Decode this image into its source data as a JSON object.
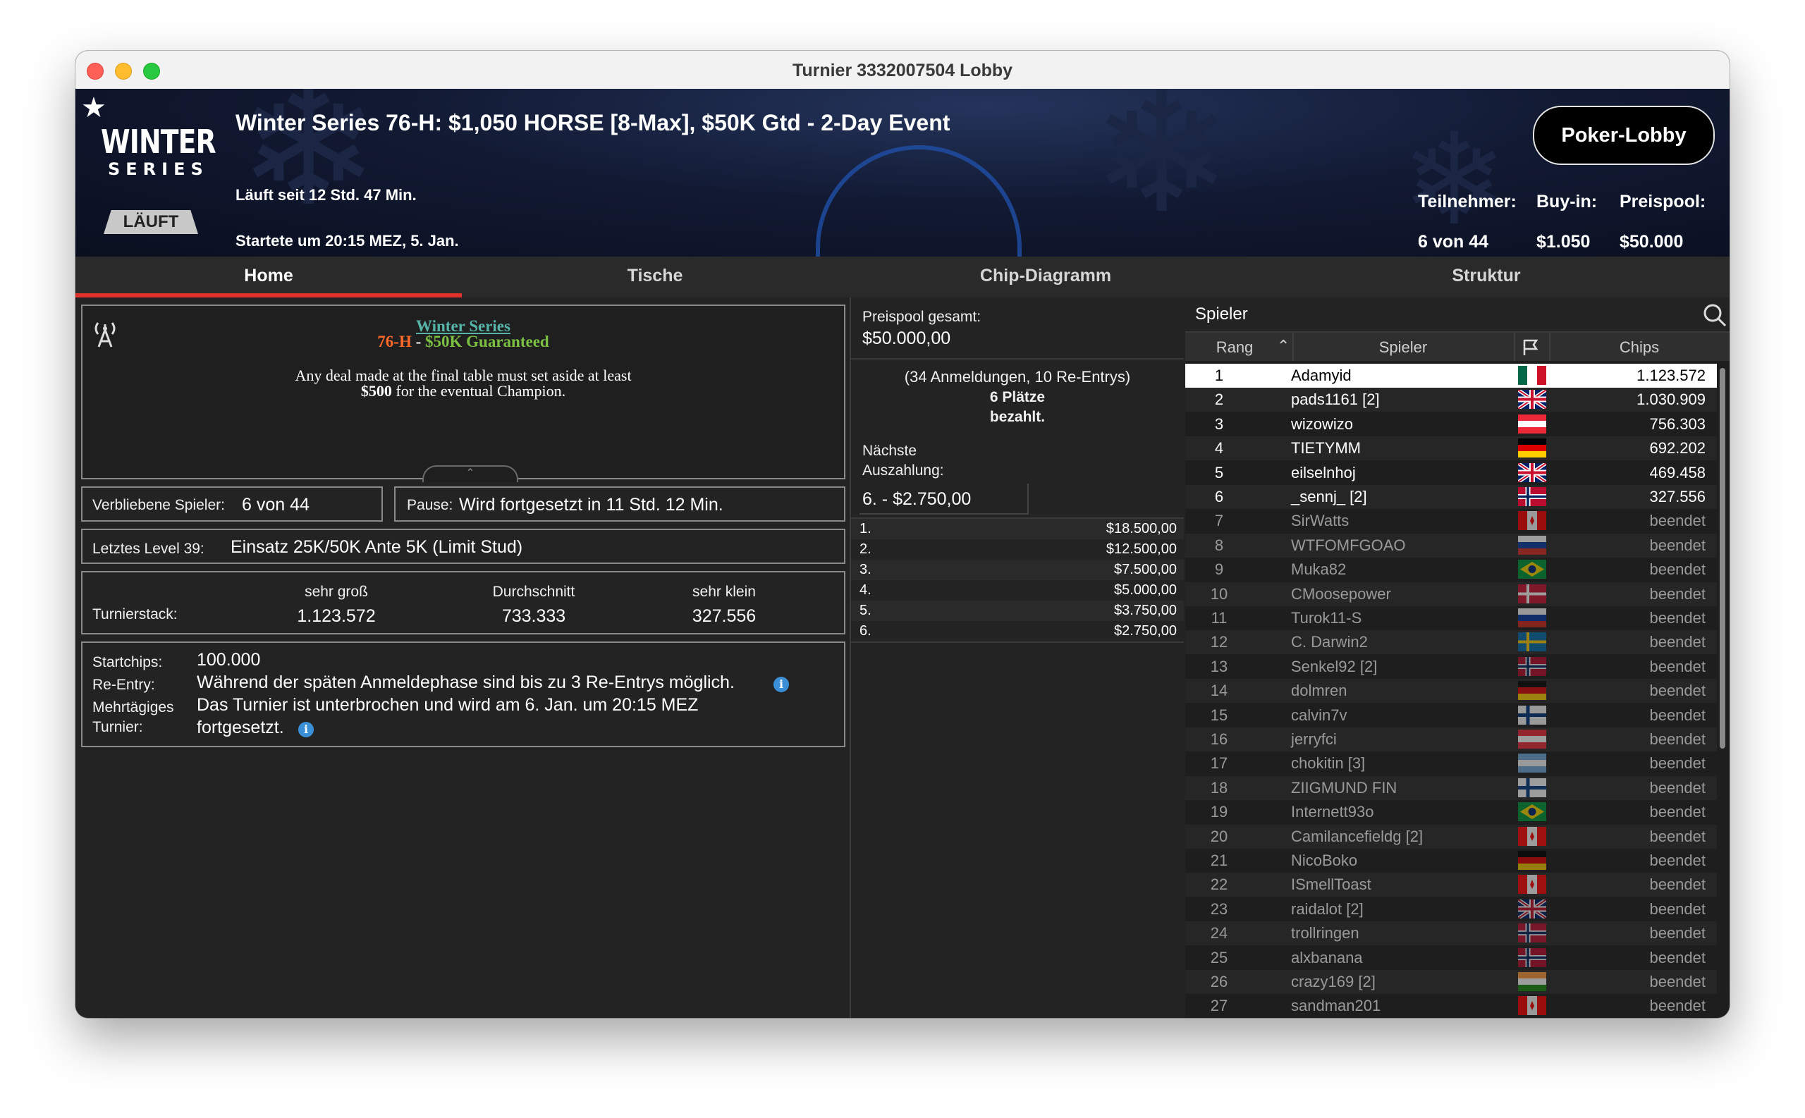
{
  "window": {
    "title": "Turnier 3332007504 Lobby"
  },
  "header": {
    "logo_top": "WINTER",
    "logo_bottom": "SERIES",
    "status": "LÄUFT",
    "event_title": "Winter Series 76-H: $1,050 HORSE [8-Max], $50K Gtd - 2-Day Event",
    "running_since": "Läuft seit 12 Std. 47 Min.",
    "started_at": "Startete um 20:15 MEZ, 5. Jan.",
    "lobby_button": "Poker-Lobby",
    "stats": [
      {
        "label": "Teilnehmer:",
        "value": "6 von 44"
      },
      {
        "label": "Buy-in:",
        "value": "$1.050"
      },
      {
        "label": "Preispool:",
        "value": "$50.000"
      }
    ]
  },
  "tabs": [
    "Home",
    "Tische",
    "Chip-Diagramm",
    "Struktur"
  ],
  "announcement": {
    "series": "Winter Series",
    "event": "76-H",
    "sep": " - ",
    "guaranteed": "$50K Guaranteed",
    "line1": "Any deal made at the final table must set aside at least",
    "amount": "$500",
    "line2_rest": " for the eventual Champion."
  },
  "remaining": {
    "label": "Verbliebene Spieler:",
    "value": "6 von 44"
  },
  "pause": {
    "label": "Pause:",
    "value": "Wird fortgesetzt in 11 Std. 12 Min."
  },
  "last_level": {
    "label": "Letztes Level 39:",
    "value": "Einsatz 25K/50K Ante 5K (Limit Stud)"
  },
  "stacks": {
    "label": "Turnierstack:",
    "cols": [
      {
        "label": "sehr groß",
        "value": "1.123.572"
      },
      {
        "label": "Durchschnitt",
        "value": "733.333"
      },
      {
        "label": "sehr klein",
        "value": "327.556"
      }
    ]
  },
  "info": {
    "startchips_label": "Startchips:",
    "startchips_value": "100.000",
    "reentry_label": "Re-Entry:",
    "reentry_value": "Während der späten Anmeldephase sind bis zu 3 Re-Entrys möglich.",
    "multiday_label1": "Mehrtägiges",
    "multiday_label2": "Turnier:",
    "multiday_value1": "Das Turnier ist unterbrochen und wird am 6. Jan. um 20:15 MEZ",
    "multiday_value2": "fortgesetzt."
  },
  "prizes": {
    "total_label": "Preispool gesamt:",
    "total_value": "$50.000,00",
    "entries": "(34 Anmeldungen, 10 Re-Entrys)",
    "paid1": "6 Plätze",
    "paid2": "bezahlt.",
    "next_label1": "Nächste",
    "next_label2": "Auszahlung:",
    "next_value": "6. - $2.750,00",
    "payouts": [
      {
        "place": "1.",
        "amount": "$18.500,00"
      },
      {
        "place": "2.",
        "amount": "$12.500,00"
      },
      {
        "place": "3.",
        "amount": "$7.500,00"
      },
      {
        "place": "4.",
        "amount": "$5.000,00"
      },
      {
        "place": "5.",
        "amount": "$3.750,00"
      },
      {
        "place": "6.",
        "amount": "$2.750,00"
      }
    ]
  },
  "players": {
    "title": "Spieler",
    "col_rank": "Rang",
    "col_player": "Spieler",
    "col_chips": "Chips",
    "rows": [
      {
        "rank": "1",
        "name": "Adamyid",
        "chips": "1.123.572",
        "flag": "mx",
        "active": true
      },
      {
        "rank": "2",
        "name": "pads1161 [2]",
        "chips": "1.030.909",
        "flag": "gb",
        "active": true
      },
      {
        "rank": "3",
        "name": "wizowizo",
        "chips": "756.303",
        "flag": "at",
        "active": true
      },
      {
        "rank": "4",
        "name": "TIETYMM",
        "chips": "692.202",
        "flag": "de",
        "active": true
      },
      {
        "rank": "5",
        "name": "eilselnhoj",
        "chips": "469.458",
        "flag": "gb",
        "active": true
      },
      {
        "rank": "6",
        "name": "_sennj_ [2]",
        "chips": "327.556",
        "flag": "no",
        "active": true
      },
      {
        "rank": "7",
        "name": "SirWatts",
        "chips": "beendet",
        "flag": "ca",
        "active": false
      },
      {
        "rank": "8",
        "name": "WTFOMFGOAO",
        "chips": "beendet",
        "flag": "ru",
        "active": false
      },
      {
        "rank": "9",
        "name": "Muka82",
        "chips": "beendet",
        "flag": "br",
        "active": false
      },
      {
        "rank": "10",
        "name": "CMoosepower",
        "chips": "beendet",
        "flag": "dk",
        "active": false
      },
      {
        "rank": "11",
        "name": "Turok11-S",
        "chips": "beendet",
        "flag": "ru",
        "active": false
      },
      {
        "rank": "12",
        "name": "C. Darwin2",
        "chips": "beendet",
        "flag": "se",
        "active": false
      },
      {
        "rank": "13",
        "name": "Senkel92 [2]",
        "chips": "beendet",
        "flag": "no",
        "active": false
      },
      {
        "rank": "14",
        "name": "dolmren",
        "chips": "beendet",
        "flag": "de",
        "active": false
      },
      {
        "rank": "15",
        "name": "calvin7v",
        "chips": "beendet",
        "flag": "fi",
        "active": false
      },
      {
        "rank": "16",
        "name": "jerryfci",
        "chips": "beendet",
        "flag": "at",
        "active": false
      },
      {
        "rank": "17",
        "name": "chokitin [3]",
        "chips": "beendet",
        "flag": "ar",
        "active": false
      },
      {
        "rank": "18",
        "name": "ZIIGMUND FIN",
        "chips": "beendet",
        "flag": "fi",
        "active": false
      },
      {
        "rank": "19",
        "name": "Internett93o",
        "chips": "beendet",
        "flag": "br",
        "active": false
      },
      {
        "rank": "20",
        "name": "Camilancefieldg [2]",
        "chips": "beendet",
        "flag": "ca",
        "active": false
      },
      {
        "rank": "21",
        "name": "NicoBoko",
        "chips": "beendet",
        "flag": "de",
        "active": false
      },
      {
        "rank": "22",
        "name": "ISmellToast",
        "chips": "beendet",
        "flag": "ca",
        "active": false
      },
      {
        "rank": "23",
        "name": "raidalot [2]",
        "chips": "beendet",
        "flag": "gb",
        "active": false
      },
      {
        "rank": "24",
        "name": "trollringen",
        "chips": "beendet",
        "flag": "no",
        "active": false
      },
      {
        "rank": "25",
        "name": "alxbanana",
        "chips": "beendet",
        "flag": "no",
        "active": false
      },
      {
        "rank": "26",
        "name": "crazy169 [2]",
        "chips": "beendet",
        "flag": "in",
        "active": false
      },
      {
        "rank": "27",
        "name": "sandman201",
        "chips": "beendet",
        "flag": "ca",
        "active": false
      }
    ]
  },
  "colors": {
    "accent_red": "#e0322b",
    "announce_teal": "#56b4a8",
    "announce_orange": "#ff6a2a",
    "announce_green": "#7bc043",
    "info_blue": "#3a8fd6"
  }
}
